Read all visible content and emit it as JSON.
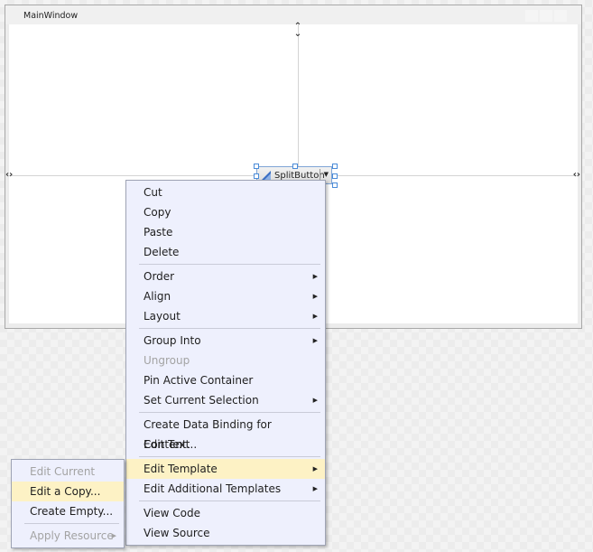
{
  "window": {
    "title": "MainWindow"
  },
  "control": {
    "label": "SplitButton",
    "icon": "split-button-icon",
    "dropdown_icon": "triangle-down"
  },
  "context_menu": {
    "groups": [
      [
        {
          "label": "Cut",
          "enabled": true,
          "submenu": false
        },
        {
          "label": "Copy",
          "enabled": true,
          "submenu": false
        },
        {
          "label": "Paste",
          "enabled": true,
          "submenu": false
        },
        {
          "label": "Delete",
          "enabled": true,
          "submenu": false
        }
      ],
      [
        {
          "label": "Order",
          "enabled": true,
          "submenu": true
        },
        {
          "label": "Align",
          "enabled": true,
          "submenu": true
        },
        {
          "label": "Layout",
          "enabled": true,
          "submenu": true
        }
      ],
      [
        {
          "label": "Group Into",
          "enabled": true,
          "submenu": true
        },
        {
          "label": "Ungroup",
          "enabled": false,
          "submenu": false
        },
        {
          "label": "Pin Active Container",
          "enabled": true,
          "submenu": false
        },
        {
          "label": "Set Current Selection",
          "enabled": true,
          "submenu": true
        }
      ],
      [
        {
          "label": "Create Data Binding for Content...",
          "enabled": true,
          "submenu": false
        },
        {
          "label": "Edit Text",
          "enabled": true,
          "submenu": false
        }
      ],
      [
        {
          "label": "Edit Template",
          "enabled": true,
          "submenu": true,
          "highlighted": true
        },
        {
          "label": "Edit Additional Templates",
          "enabled": true,
          "submenu": true
        }
      ],
      [
        {
          "label": "View Code",
          "enabled": true,
          "submenu": false
        },
        {
          "label": "View Source",
          "enabled": true,
          "submenu": false
        }
      ]
    ]
  },
  "template_submenu": {
    "groups": [
      [
        {
          "label": "Edit Current",
          "enabled": false,
          "submenu": false
        },
        {
          "label": "Edit a Copy...",
          "enabled": true,
          "submenu": false,
          "highlighted": true
        },
        {
          "label": "Create Empty...",
          "enabled": true,
          "submenu": false
        }
      ],
      [
        {
          "label": "Apply Resource",
          "enabled": false,
          "submenu": true
        }
      ]
    ]
  },
  "icons": {
    "submenu_arrow": "▶"
  }
}
